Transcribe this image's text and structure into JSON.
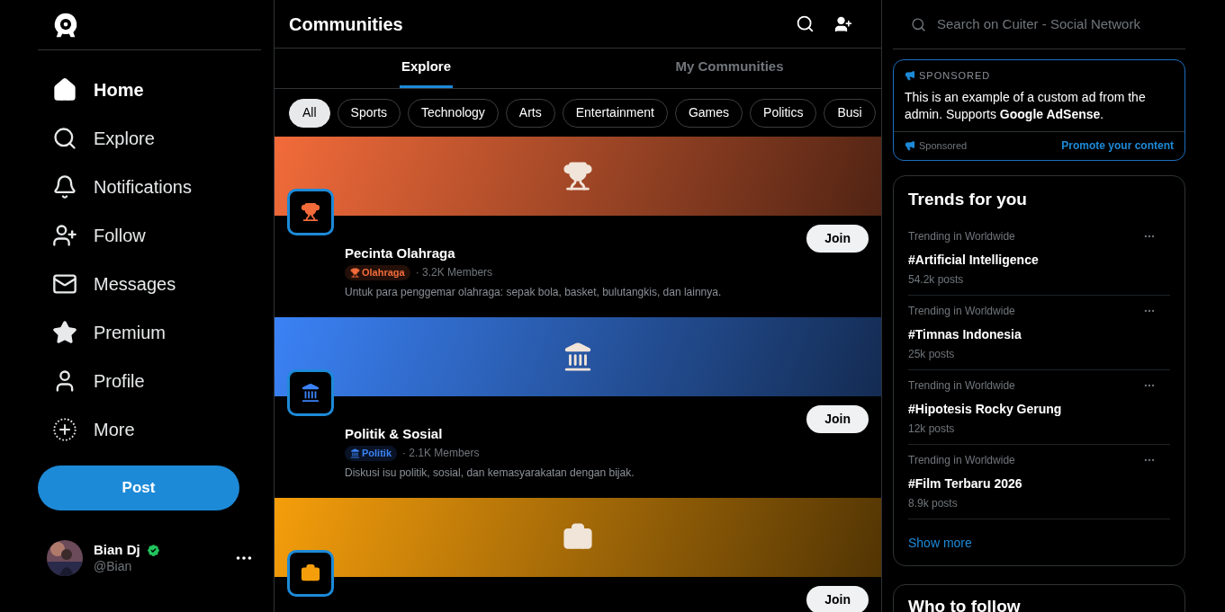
{
  "nav": [
    {
      "kind": "home",
      "label": "Home",
      "selected": true
    },
    {
      "kind": "explore",
      "label": "Explore",
      "selected": false
    },
    {
      "kind": "notifications",
      "label": "Notifications",
      "selected": false
    },
    {
      "kind": "follow",
      "label": "Follow",
      "selected": false
    },
    {
      "kind": "messages",
      "label": "Messages",
      "selected": false
    },
    {
      "kind": "premium",
      "label": "Premium",
      "selected": false
    },
    {
      "kind": "profile",
      "label": "Profile",
      "selected": false
    },
    {
      "kind": "more",
      "label": "More",
      "selected": false
    }
  ],
  "post_button": "Post",
  "user": {
    "name": "Bian Dj",
    "handle": "@Bian",
    "verified": true
  },
  "header": {
    "title": "Communities"
  },
  "tabs": [
    {
      "label": "Explore",
      "selected": true
    },
    {
      "label": "My Communities",
      "selected": false
    }
  ],
  "categories": [
    {
      "label": "All",
      "selected": true
    },
    {
      "label": "Sports",
      "selected": false
    },
    {
      "label": "Technology",
      "selected": false
    },
    {
      "label": "Arts",
      "selected": false
    },
    {
      "label": "Entertainment",
      "selected": false
    },
    {
      "label": "Games",
      "selected": false
    },
    {
      "label": "Politics",
      "selected": false
    },
    {
      "label": "Busi",
      "selected": false
    }
  ],
  "communities": [
    {
      "kind": "trophy",
      "color": "#f26b3a",
      "name": "Pecinta Olahraga",
      "tag": "Olahraga",
      "members": "· 3.2K Members",
      "description": "Untuk para penggemar olahraga: sepak bola, basket, bulutangkis, dan lainnya.",
      "join": "Join"
    },
    {
      "kind": "landmark",
      "color": "#3b82f6",
      "name": "Politik & Sosial",
      "tag": "Politik",
      "members": "· 2.1K Members",
      "description": "Diskusi isu politik, sosial, dan kemasyarakatan dengan bijak.",
      "join": "Join"
    },
    {
      "kind": "briefcase",
      "color": "#f59e0b",
      "join": "Join"
    }
  ],
  "search": {
    "placeholder": "Search on Cuiter - Social Network"
  },
  "ad": {
    "label": "SPONSORED",
    "text": "This is an example of a custom ad from the admin. Supports **Google AdSense**.",
    "footer": "Sponsored",
    "link": "Promote your content"
  },
  "trends": {
    "title": "Trends for you",
    "items": [
      {
        "context": "Trending in Worldwide",
        "topic": "#Artificial Intelligence",
        "posts": "54.2k posts"
      },
      {
        "context": "Trending in Worldwide",
        "topic": "#Timnas Indonesia",
        "posts": "25k posts"
      },
      {
        "context": "Trending in Worldwide",
        "topic": "#Hipotesis Rocky Gerung",
        "posts": "12k posts"
      },
      {
        "context": "Trending in Worldwide",
        "topic": "#Film Terbaru 2026",
        "posts": "8.9k posts"
      }
    ],
    "show_more": "Show more"
  },
  "who_to_follow": {
    "title": "Who to follow"
  }
}
